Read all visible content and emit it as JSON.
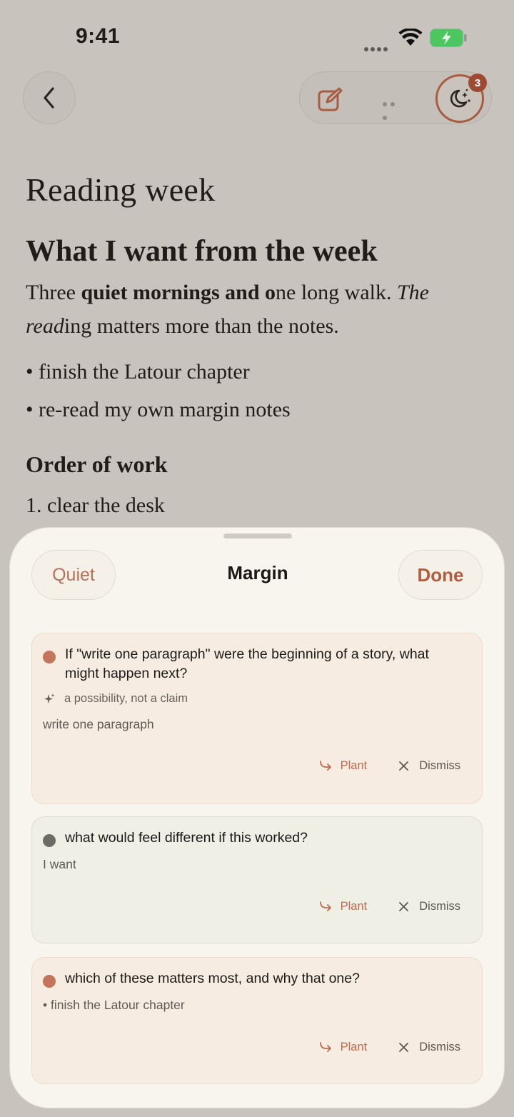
{
  "status_bar": {
    "time": "9:41"
  },
  "toolbar": {
    "badge_count": "3"
  },
  "document": {
    "title": "Reading week",
    "heading1": "What I want from the week",
    "paragraph": {
      "part1": "Three ",
      "bold1": "quiet mornings and o",
      "part2": "ne long walk. ",
      "italic1": "The read",
      "part3": "ing matters more than the notes."
    },
    "bullets": [
      "• finish the Latour chapter",
      "• re-read my own margin notes"
    ],
    "heading2": "Order of work",
    "ordered": [
      "1. clear the desk"
    ]
  },
  "sheet": {
    "quiet_label": "Quiet",
    "title": "Margin",
    "done_label": "Done",
    "cards": [
      {
        "question": "If \"write one paragraph\" were the beginning of a story, what might happen next?",
        "hint": "a possibility, not a claim",
        "anchor": "write one paragraph",
        "plant_label": "Plant",
        "dismiss_label": "Dismiss"
      },
      {
        "question": "what would feel different if this worked?",
        "anchor": "I want",
        "plant_label": "Plant",
        "dismiss_label": "Dismiss"
      },
      {
        "question": "which of these matters most, and why that one?",
        "anchor": "• finish the Latour chapter",
        "plant_label": "Plant",
        "dismiss_label": "Dismiss"
      }
    ]
  },
  "colors": {
    "accent": "#b45c3e",
    "badge": "#9e4a32",
    "background": "#c8c4bd",
    "sheet": "#f8f5ee"
  },
  "icons": [
    "back-chevron-icon",
    "edit-icon",
    "more-icon",
    "moon-sparkle-icon",
    "sparkle-icon",
    "plant-arrow-icon",
    "close-icon",
    "wifi-icon",
    "battery-charging-icon"
  ]
}
